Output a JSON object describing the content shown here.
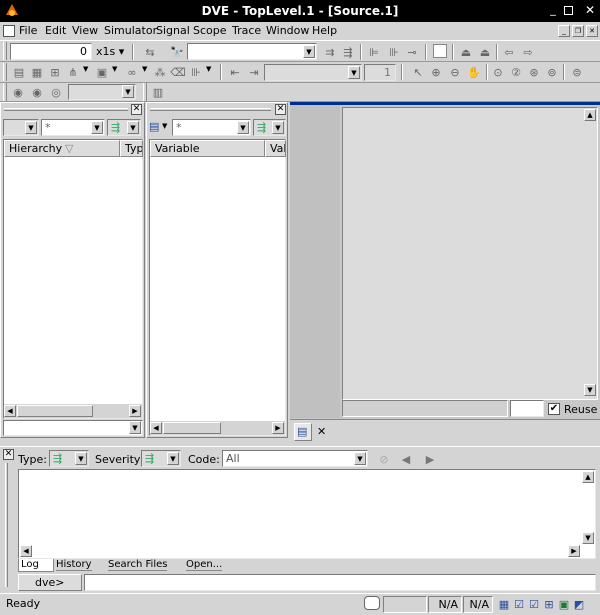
{
  "window": {
    "title": "DVE - TopLevel.1 - [Source.1]"
  },
  "menu": [
    {
      "label": "File"
    },
    {
      "label": "Edit"
    },
    {
      "label": "View"
    },
    {
      "label": "Simulator"
    },
    {
      "label": "Signal"
    },
    {
      "label": "Scope"
    },
    {
      "label": "Trace"
    },
    {
      "label": "Window"
    },
    {
      "label": "Help"
    }
  ],
  "toolbar1": {
    "time_value": "0",
    "time_unit": "x1s"
  },
  "toolbar2": {
    "step_value": "1"
  },
  "hierarchy_pane": {
    "filter": "*",
    "columns": [
      "Hierarchy",
      "Typ"
    ]
  },
  "variable_pane": {
    "filter": "*",
    "columns": [
      "Variable",
      "Val"
    ]
  },
  "source_pane": {
    "reuse_label": "Reuse",
    "reuse_checked": true
  },
  "console": {
    "type_label": "Type:",
    "severity_label": "Severity:",
    "code_label": "Code:",
    "code_value": "All",
    "tabs": [
      {
        "label": "Log"
      },
      {
        "label": "History"
      },
      {
        "label": "Search Files"
      },
      {
        "label": "Open..."
      }
    ],
    "prompt": "dve>"
  },
  "status": {
    "text": "Ready",
    "field1": "N/A",
    "field2": "N/A"
  }
}
